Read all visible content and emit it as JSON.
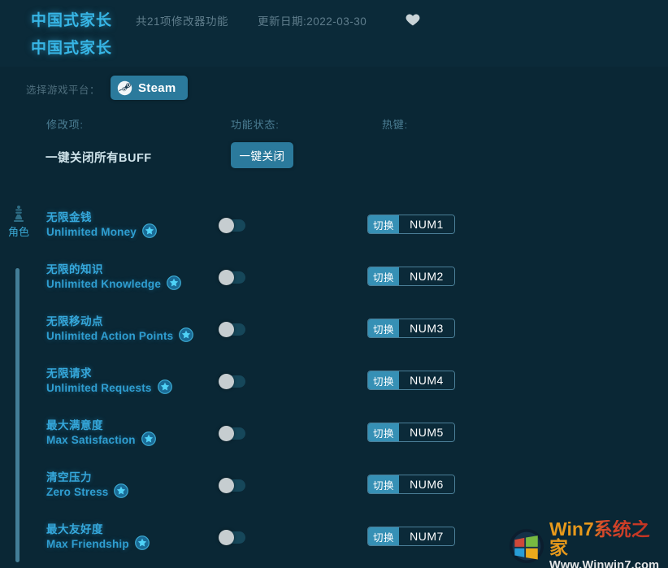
{
  "header": {
    "title": "中国式家长",
    "subtitle": "中国式家长",
    "feature_count": "共21项修改器功能",
    "update_date": "更新日期:2022-03-30",
    "favorite_icon": "heart-icon"
  },
  "platform": {
    "label": "选择游戏平台：",
    "selected": "Steam",
    "icon": "steam-icon"
  },
  "columns": {
    "option": "修改项:",
    "status": "功能状态:",
    "hotkey": "热键:"
  },
  "master": {
    "label": "一键关闭所有BUFF",
    "button": "一键关闭"
  },
  "category": {
    "icon": "chess-pawn-icon",
    "label": "角色"
  },
  "cheats": [
    {
      "cn": "无限金钱",
      "en": "Unlimited Money",
      "star": "star-icon",
      "toggle": "off",
      "hk_action": "切换",
      "hk_key": "NUM1"
    },
    {
      "cn": "无限的知识",
      "en": "Unlimited Knowledge",
      "star": "star-icon",
      "toggle": "off",
      "hk_action": "切换",
      "hk_key": "NUM2"
    },
    {
      "cn": "无限移动点",
      "en": "Unlimited Action Points",
      "star": "star-icon",
      "toggle": "off",
      "hk_action": "切换",
      "hk_key": "NUM3"
    },
    {
      "cn": "无限请求",
      "en": "Unlimited Requests",
      "star": "star-icon",
      "toggle": "off",
      "hk_action": "切换",
      "hk_key": "NUM4"
    },
    {
      "cn": "最大满意度",
      "en": "Max Satisfaction",
      "star": "star-icon",
      "toggle": "off",
      "hk_action": "切换",
      "hk_key": "NUM5"
    },
    {
      "cn": "清空压力",
      "en": "Zero Stress",
      "star": "star-icon",
      "toggle": "off",
      "hk_action": "切换",
      "hk_key": "NUM6"
    },
    {
      "cn": "最大友好度",
      "en": "Max Friendship",
      "star": "star-icon",
      "toggle": "off",
      "hk_action": "切换",
      "hk_key": "NUM7"
    }
  ],
  "watermark": {
    "title": "Win7系统之家",
    "url": "Www.Winwin7.com",
    "icon": "windows-logo-icon"
  },
  "colors": {
    "background": "#0a2735",
    "accent": "#2b7a9c",
    "label_blue": "#35a8dc",
    "muted": "#5f7d8c"
  }
}
